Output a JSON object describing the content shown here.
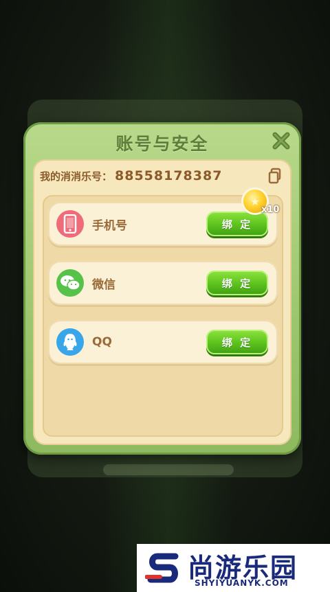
{
  "dialog": {
    "title": "账号与安全",
    "account_label": "我的消消乐号：",
    "account_number": "88558178387",
    "reward_count": "x10",
    "bind_rows": [
      {
        "label": "手机号",
        "button": "绑 定",
        "icon": "phone-icon",
        "icon_color": "#ef6b7a"
      },
      {
        "label": "微信",
        "button": "绑 定",
        "icon": "wechat-icon",
        "icon_color": "#56c24a"
      },
      {
        "label": "QQ",
        "button": "绑 定",
        "icon": "qq-icon",
        "icon_color": "#3aa6ea"
      }
    ]
  },
  "watermark": {
    "brand": "尚游乐园",
    "domain": "SHYIYUANYK.COM"
  },
  "colors": {
    "dialog_green": "#9cc66d",
    "panel_cream": "#f7e7bd",
    "text_brown": "#8a5a2b",
    "button_green": "#5cc21d"
  }
}
